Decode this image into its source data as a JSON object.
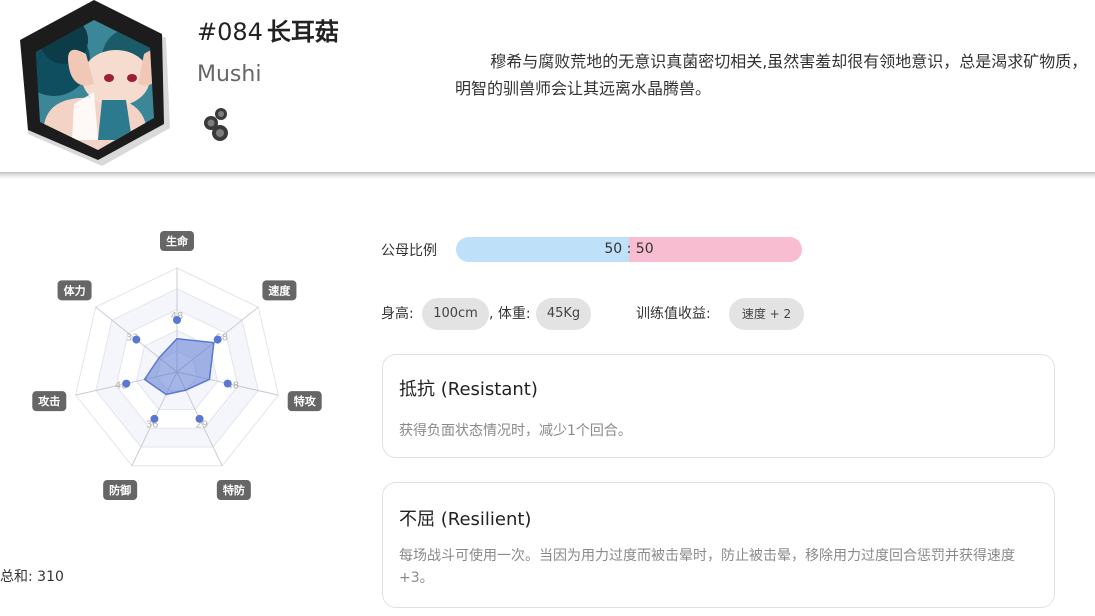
{
  "header": {
    "number": "#084",
    "name_cn": "长耳菇",
    "name_en": "Mushi",
    "description": "穆希与腐败荒地的无意识真菌密切相关,虽然害羞却很有领地意识，总是渴求矿物质，明智的驯兽师会让其远离水晶腾兽。",
    "avatar_icon": "mushi-portrait-icon",
    "type_icon": "type-poison-icon"
  },
  "radar": {
    "labels": [
      "生命",
      "速度",
      "特攻",
      "特防",
      "防御",
      "攻击",
      "体力"
    ],
    "values": [
      48,
      68,
      48,
      29,
      36,
      48,
      33
    ],
    "max": 150,
    "fill_color": "#5a78d1",
    "total_label": "总和: 310"
  },
  "gender": {
    "label": "公母比例",
    "ratio_text": "50 : 50",
    "male_fraction": 0.5,
    "male_color": "#bfe0f9",
    "female_color": "#f9bdd2"
  },
  "stats": {
    "height_label": "身高:",
    "height_value": "100cm",
    "weight_label": ", 体重:",
    "weight_value": "45Kg",
    "ev_label": "训练值收益:",
    "ev_value": "速度 + 2"
  },
  "traits": [
    {
      "title": "抵抗 (Resistant)",
      "description": "获得负面状态情况时，减少1个回合。"
    },
    {
      "title": "不屈 (Resilient)",
      "description": "每场战斗可使用一次。当因为用力过度而被击晕时，防止被击晕，移除用力过度回合惩罚并获得速度+3。"
    }
  ]
}
